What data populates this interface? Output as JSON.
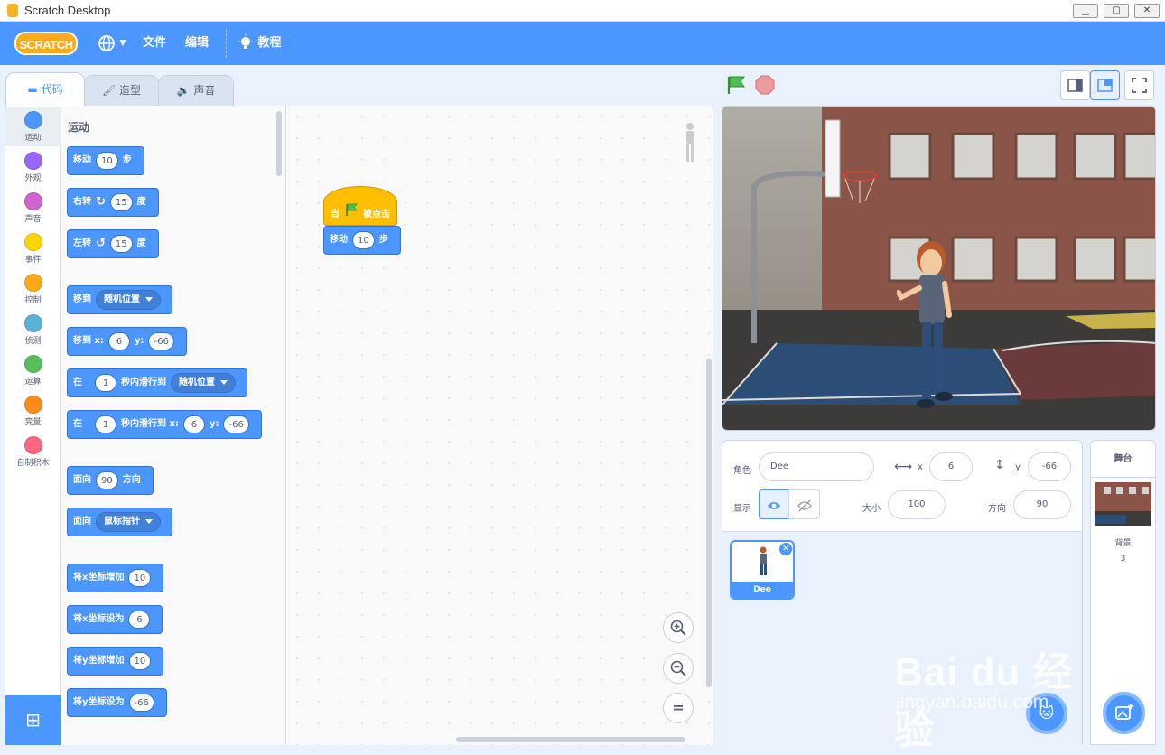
{
  "window": {
    "title": "Scratch Desktop",
    "controls": [
      "minimize",
      "maximize",
      "close"
    ]
  },
  "menubar": {
    "logo": "SCRATCH",
    "file": "文件",
    "edit": "编辑",
    "tutorials": "教程"
  },
  "tabs": {
    "code": "代码",
    "costumes": "造型",
    "sounds": "声音"
  },
  "categories": [
    {
      "label": "运动",
      "color": "#4c97ff"
    },
    {
      "label": "外观",
      "color": "#9966ff"
    },
    {
      "label": "声音",
      "color": "#cf63cf"
    },
    {
      "label": "事件",
      "color": "#ffd500"
    },
    {
      "label": "控制",
      "color": "#ffab19"
    },
    {
      "label": "侦测",
      "color": "#5cb1d6"
    },
    {
      "label": "运算",
      "color": "#59c059"
    },
    {
      "label": "变量",
      "color": "#ff8c1a"
    },
    {
      "label": "自制积木",
      "color": "#ff6680"
    }
  ],
  "palette": {
    "title": "运动",
    "move": {
      "label": "移动",
      "val": "10",
      "unit": "步"
    },
    "turn_right": {
      "label": "右转",
      "val": "15",
      "unit": "度"
    },
    "turn_left": {
      "label": "左转",
      "val": "15",
      "unit": "度"
    },
    "goto": {
      "label": "移到",
      "dd": "随机位置"
    },
    "goto_xy": {
      "label": "移到 x:",
      "x": "6",
      "ylabel": "y:",
      "y": "-66"
    },
    "glide": {
      "label": "在",
      "secs": "1",
      "mid": "秒内滑行到",
      "dd": "随机位置"
    },
    "glide_xy": {
      "label": "在",
      "secs": "1",
      "mid": "秒内滑行到 x:",
      "x": "6",
      "ylabel": "y:",
      "y": "-66"
    },
    "point_dir": {
      "label": "面向",
      "val": "90",
      "unit": "方向"
    },
    "point_towards": {
      "label": "面向",
      "dd": "鼠标指针"
    },
    "change_x": {
      "label": "将x坐标增加",
      "val": "10"
    },
    "set_x": {
      "label": "将x坐标设为",
      "val": "6"
    },
    "change_y": {
      "label": "将y坐标增加",
      "val": "10"
    },
    "set_y": {
      "label": "将y坐标设为",
      "val": "-66"
    }
  },
  "script": {
    "hat": {
      "when": "当",
      "clicked": "被点击"
    },
    "move": {
      "label": "移动",
      "val": "10",
      "unit": "步"
    }
  },
  "zoom": {
    "in": "+",
    "out": "−",
    "reset": "="
  },
  "sprite_info": {
    "sprite_label": "角色",
    "sprite_name": "Dee",
    "x_label": "x",
    "x": "6",
    "y_label": "y",
    "y": "-66",
    "show_label": "显示",
    "size_label": "大小",
    "size": "100",
    "direction_label": "方向",
    "direction": "90"
  },
  "sprites": [
    {
      "name": "Dee"
    }
  ],
  "stage_panel": {
    "title": "舞台",
    "backdrops_label": "背景",
    "backdrops_count": "3"
  },
  "watermark": {
    "main": "Bai du 经验",
    "sub": "jingyan.baidu.com"
  }
}
